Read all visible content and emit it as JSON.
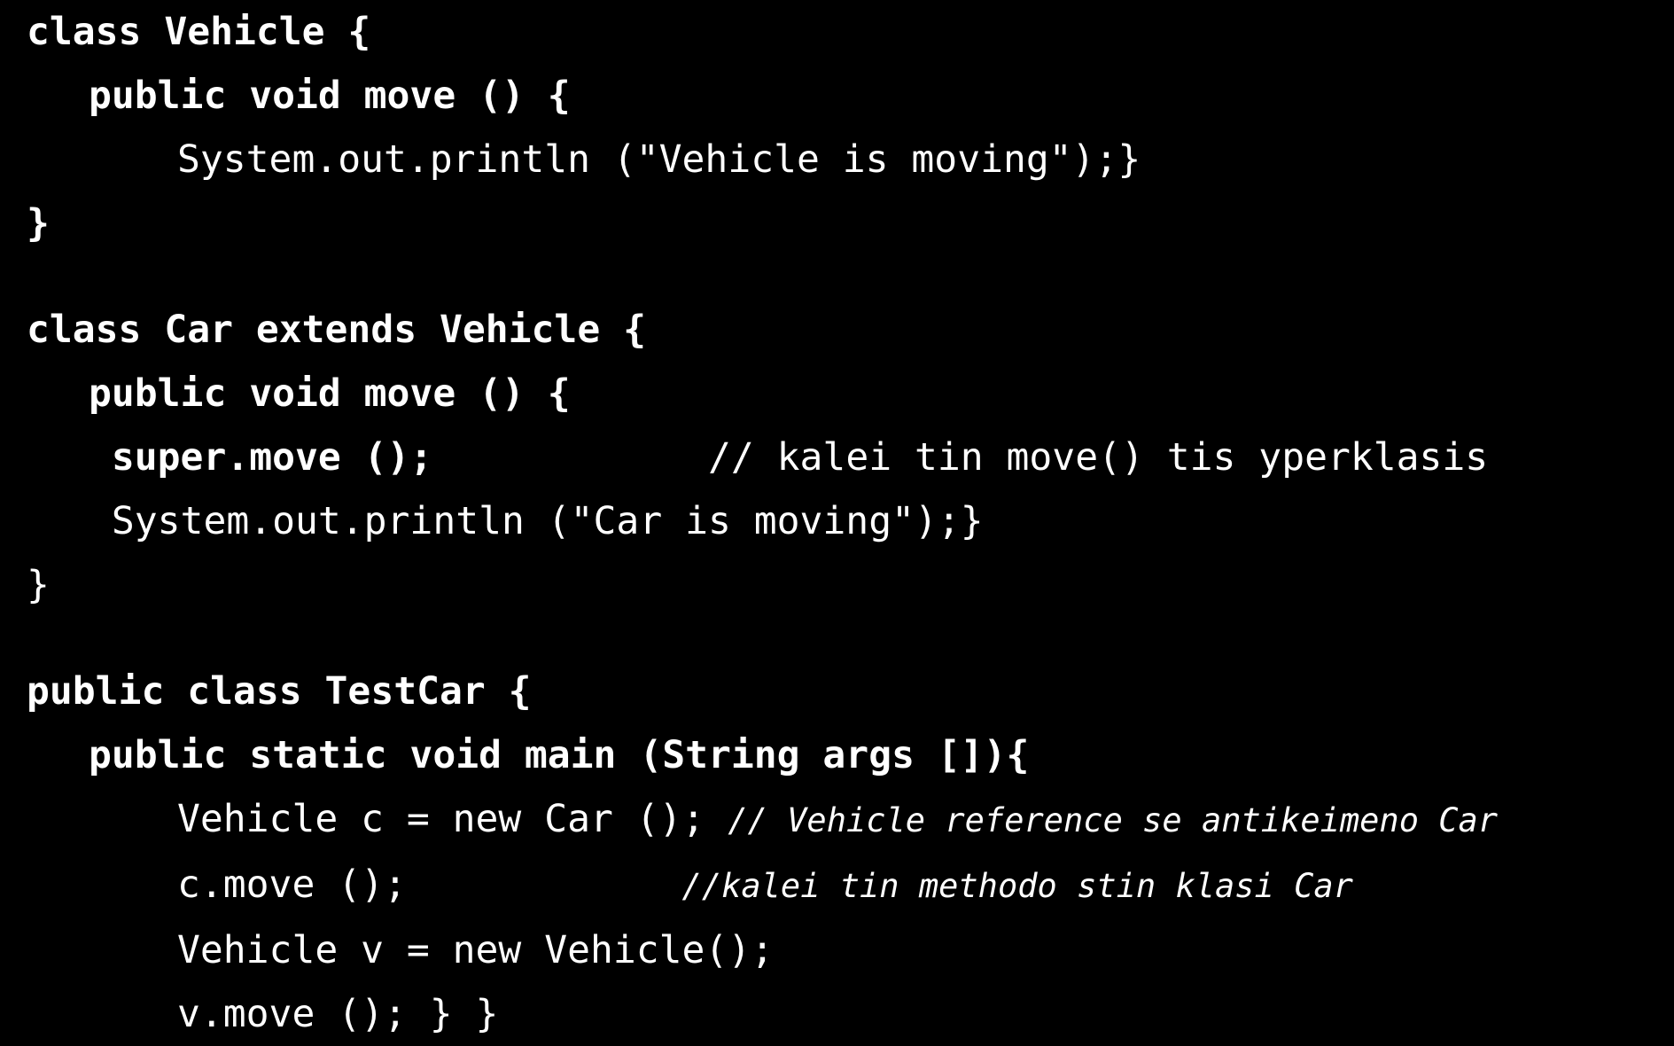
{
  "slide": {
    "background_color": "#000000",
    "text_color": "#ffffff",
    "language": "java",
    "title": ""
  },
  "code": {
    "blocks": [
      {
        "name": "vehicle-class",
        "lines": [
          {
            "id": "line-1",
            "indent": 0,
            "segments": [
              {
                "text": "class Vehicle {",
                "style": "bold"
              }
            ]
          },
          {
            "id": "line-2",
            "indent": 1,
            "segments": [
              {
                "text": "public void move () {",
                "style": "bold"
              }
            ]
          },
          {
            "id": "line-3",
            "indent": 2,
            "segments": [
              {
                "text": "System.out.println (\"Vehicle is moving\");}",
                "style": "normal"
              }
            ]
          },
          {
            "id": "line-4",
            "indent": 0,
            "segments": [
              {
                "text": "}",
                "style": "bold"
              }
            ]
          }
        ]
      },
      {
        "name": "car-class",
        "lines": [
          {
            "id": "line-5",
            "indent": 0,
            "segments": [
              {
                "text": "class Car extends Vehicle {",
                "style": "bold"
              }
            ]
          },
          {
            "id": "line-6",
            "indent": 1,
            "segments": [
              {
                "text": "public void move () {",
                "style": "bold"
              }
            ]
          },
          {
            "id": "line-7",
            "indent": 1,
            "segments": [
              {
                "text": " super.move ();",
                "style": "bold"
              },
              {
                "text": "            // kalei tin move() tis yperklasis",
                "style": "normal"
              }
            ]
          },
          {
            "id": "line-8",
            "indent": 1,
            "segments": [
              {
                "text": " System.out.println (\"Car is moving\");}",
                "style": "normal"
              }
            ]
          },
          {
            "id": "line-9",
            "indent": 0,
            "segments": [
              {
                "text": "}",
                "style": "normal"
              }
            ]
          }
        ]
      },
      {
        "name": "testcar-class",
        "lines": [
          {
            "id": "line-10",
            "indent": 0,
            "segments": [
              {
                "text": "public class TestCar {",
                "style": "bold"
              }
            ]
          },
          {
            "id": "line-11",
            "indent": 1,
            "segments": [
              {
                "text": "public static void main (String args []){",
                "style": "bold"
              }
            ]
          },
          {
            "id": "line-12",
            "indent": 2,
            "segments": [
              {
                "text": "Vehicle c = new Car (); ",
                "style": "normal"
              },
              {
                "text": "// Vehicle reference se antikeimeno Car",
                "style": "italic-small"
              }
            ]
          },
          {
            "id": "line-13",
            "indent": 2,
            "segments": [
              {
                "text": "c.move ();            ",
                "style": "normal"
              },
              {
                "text": "//kalei tin methodo stin klasi Car",
                "style": "italic-small"
              }
            ]
          },
          {
            "id": "line-14",
            "indent": 2,
            "segments": [
              {
                "text": "Vehicle v = new Vehicle();",
                "style": "normal"
              }
            ]
          },
          {
            "id": "line-15",
            "indent": 2,
            "segments": [
              {
                "text": "v.move (); } }",
                "style": "normal"
              }
            ]
          }
        ]
      }
    ]
  }
}
